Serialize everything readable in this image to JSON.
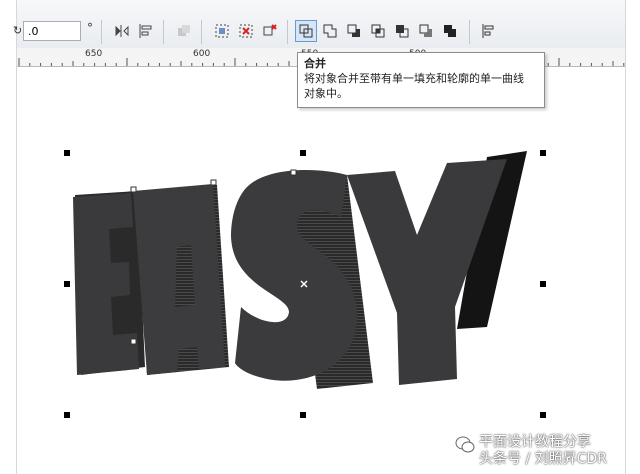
{
  "toolbar": {
    "rotation_value": ".0",
    "degree_symbol": "°",
    "buttons": [
      {
        "name": "mirror-icon"
      },
      {
        "name": "align-icon"
      },
      {
        "name": "arrange-icon"
      },
      {
        "name": "group-icon"
      },
      {
        "name": "ungroup-icon"
      },
      {
        "name": "ungroup-all-icon"
      },
      {
        "name": "combine-icon"
      },
      {
        "name": "weld-icon"
      },
      {
        "name": "trim-icon"
      },
      {
        "name": "intersect-icon"
      },
      {
        "name": "simplify-icon"
      },
      {
        "name": "front-minus-back-icon"
      },
      {
        "name": "back-minus-front-icon"
      },
      {
        "name": "create-boundary-icon"
      },
      {
        "name": "align-distribute-icon"
      }
    ]
  },
  "ruler": {
    "labels": [
      "650",
      "600",
      "550",
      "500"
    ]
  },
  "tooltip": {
    "title": "合并",
    "line1": "将对象合并至带有单一填充和轮廓的单一曲线",
    "line2": "对象中。"
  },
  "artwork": {
    "text": "EASY",
    "face_color": "#3a3a3c",
    "side_color": "#151515"
  },
  "watermark": {
    "line1": "平面设计教程分享",
    "line2": "头条号 / 刘照昇CDR"
  }
}
